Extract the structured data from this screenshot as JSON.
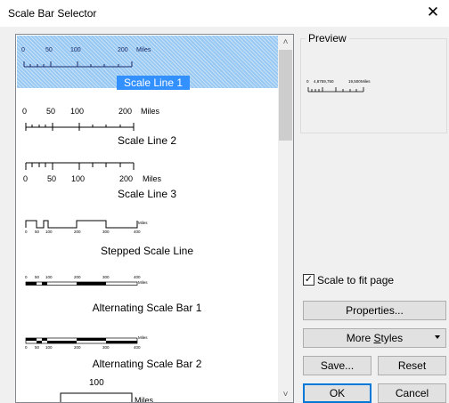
{
  "window": {
    "title": "Scale Bar Selector",
    "close_glyph": "✕"
  },
  "styles_list": {
    "items": [
      {
        "label": "Scale Line 1",
        "selected": true
      },
      {
        "label": "Scale Line 2"
      },
      {
        "label": "Scale Line 3"
      },
      {
        "label": "Stepped Scale Line"
      },
      {
        "label": "Alternating Scale Bar 1"
      },
      {
        "label": "Alternating Scale Bar 2"
      }
    ],
    "ticks": {
      "zero": "0",
      "fifty": "50",
      "hundred": "100",
      "twohundred": "200",
      "threehundred": "300",
      "fourhundred": "400",
      "miles": "Miles"
    },
    "partial_item": {
      "value": "100",
      "unit": "Miles"
    },
    "scroll_up_glyph": "˄",
    "scroll_down_glyph": "˅"
  },
  "preview": {
    "label": "Preview",
    "ticks": {
      "zero": "0",
      "mid": "4,8759,750",
      "end": "19,500",
      "unit": "Miles"
    }
  },
  "scale_to_fit": {
    "label": "Scale to fit page",
    "checked": true,
    "check_glyph": "✓"
  },
  "buttons": {
    "properties": "Properties...",
    "more_styles_prefix": "More ",
    "more_styles_underlined": "S",
    "more_styles_suffix": "tyles",
    "save": "Save...",
    "reset": "Reset",
    "ok": "OK",
    "cancel": "Cancel"
  }
}
